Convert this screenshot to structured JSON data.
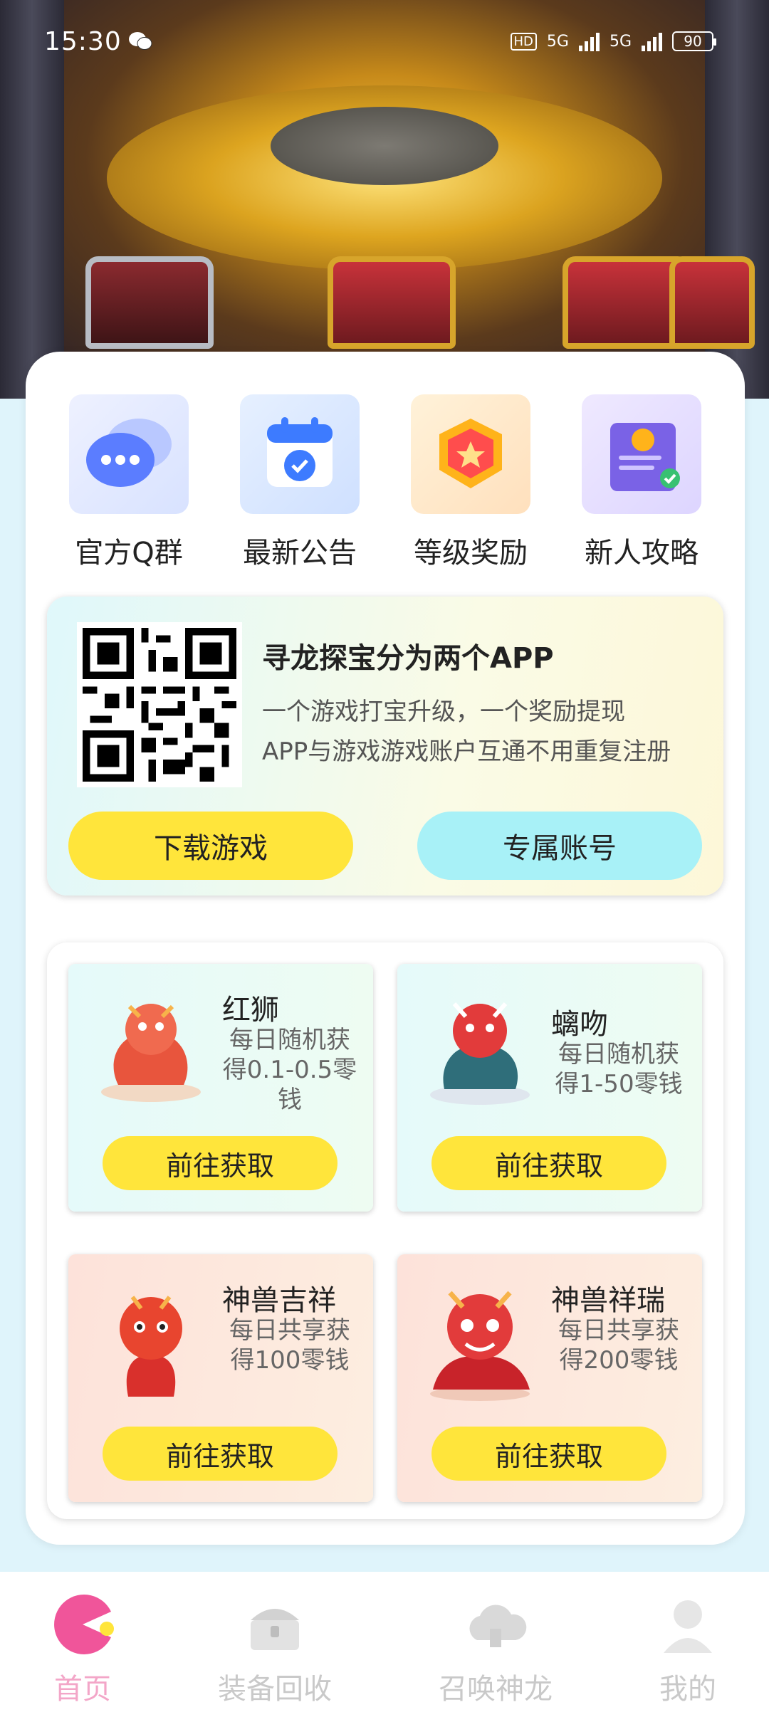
{
  "status_bar": {
    "time": "15:30",
    "battery": "90",
    "network_1": "5G",
    "network_2": "5G",
    "hd_label": "HD"
  },
  "quick_actions": [
    {
      "label": "官方Q群",
      "icon": "chat-bubbles-icon"
    },
    {
      "label": "最新公告",
      "icon": "calendar-badge-icon"
    },
    {
      "label": "等级奖励",
      "icon": "shield-badge-icon"
    },
    {
      "label": "新人攻略",
      "icon": "scroll-certificate-icon"
    }
  ],
  "info_card": {
    "title": "寻龙探宝分为两个APP",
    "line1": "一个游戏打宝升级，一个奖励提现",
    "line2": "APP与游戏游戏账户互通不用重复注册",
    "download_label": "下载游戏",
    "account_label": "专属账号"
  },
  "rewards": [
    {
      "name": "红狮",
      "desc": "每日随机获得0.1-0.5零钱",
      "action": "前往获取"
    },
    {
      "name": "螭吻",
      "desc": "每日随机获得1-50零钱",
      "action": "前往获取"
    },
    {
      "name": "神兽吉祥",
      "desc": "每日共享获得100零钱",
      "action": "前往获取"
    },
    {
      "name": "神兽祥瑞",
      "desc": "每日共享获得200零钱",
      "action": "前往获取"
    }
  ],
  "bottom_nav": [
    {
      "label": "首页",
      "icon": "pacman-home-icon",
      "active": true
    },
    {
      "label": "装备回收",
      "icon": "chest-recycle-icon",
      "active": false
    },
    {
      "label": "召唤神龙",
      "icon": "cloud-dragon-icon",
      "active": false
    },
    {
      "label": "我的",
      "icon": "user-icon",
      "active": false
    }
  ],
  "colors": {
    "accent_yellow": "#ffe53b",
    "accent_cyan": "#a8f1f7",
    "active_nav": "#f3a6c8"
  }
}
